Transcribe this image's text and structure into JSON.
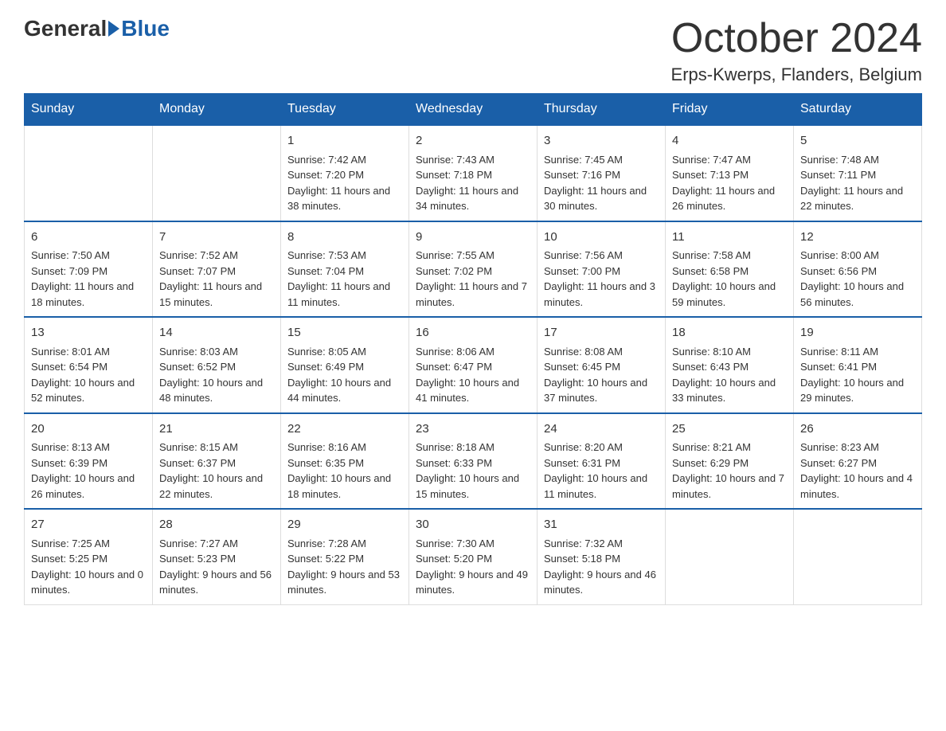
{
  "header": {
    "logo_general": "General",
    "logo_blue": "Blue",
    "month_title": "October 2024",
    "location": "Erps-Kwerps, Flanders, Belgium"
  },
  "weekdays": [
    "Sunday",
    "Monday",
    "Tuesday",
    "Wednesday",
    "Thursday",
    "Friday",
    "Saturday"
  ],
  "weeks": [
    [
      {
        "day": "",
        "sunrise": "",
        "sunset": "",
        "daylight": ""
      },
      {
        "day": "",
        "sunrise": "",
        "sunset": "",
        "daylight": ""
      },
      {
        "day": "1",
        "sunrise": "Sunrise: 7:42 AM",
        "sunset": "Sunset: 7:20 PM",
        "daylight": "Daylight: 11 hours and 38 minutes."
      },
      {
        "day": "2",
        "sunrise": "Sunrise: 7:43 AM",
        "sunset": "Sunset: 7:18 PM",
        "daylight": "Daylight: 11 hours and 34 minutes."
      },
      {
        "day": "3",
        "sunrise": "Sunrise: 7:45 AM",
        "sunset": "Sunset: 7:16 PM",
        "daylight": "Daylight: 11 hours and 30 minutes."
      },
      {
        "day": "4",
        "sunrise": "Sunrise: 7:47 AM",
        "sunset": "Sunset: 7:13 PM",
        "daylight": "Daylight: 11 hours and 26 minutes."
      },
      {
        "day": "5",
        "sunrise": "Sunrise: 7:48 AM",
        "sunset": "Sunset: 7:11 PM",
        "daylight": "Daylight: 11 hours and 22 minutes."
      }
    ],
    [
      {
        "day": "6",
        "sunrise": "Sunrise: 7:50 AM",
        "sunset": "Sunset: 7:09 PM",
        "daylight": "Daylight: 11 hours and 18 minutes."
      },
      {
        "day": "7",
        "sunrise": "Sunrise: 7:52 AM",
        "sunset": "Sunset: 7:07 PM",
        "daylight": "Daylight: 11 hours and 15 minutes."
      },
      {
        "day": "8",
        "sunrise": "Sunrise: 7:53 AM",
        "sunset": "Sunset: 7:04 PM",
        "daylight": "Daylight: 11 hours and 11 minutes."
      },
      {
        "day": "9",
        "sunrise": "Sunrise: 7:55 AM",
        "sunset": "Sunset: 7:02 PM",
        "daylight": "Daylight: 11 hours and 7 minutes."
      },
      {
        "day": "10",
        "sunrise": "Sunrise: 7:56 AM",
        "sunset": "Sunset: 7:00 PM",
        "daylight": "Daylight: 11 hours and 3 minutes."
      },
      {
        "day": "11",
        "sunrise": "Sunrise: 7:58 AM",
        "sunset": "Sunset: 6:58 PM",
        "daylight": "Daylight: 10 hours and 59 minutes."
      },
      {
        "day": "12",
        "sunrise": "Sunrise: 8:00 AM",
        "sunset": "Sunset: 6:56 PM",
        "daylight": "Daylight: 10 hours and 56 minutes."
      }
    ],
    [
      {
        "day": "13",
        "sunrise": "Sunrise: 8:01 AM",
        "sunset": "Sunset: 6:54 PM",
        "daylight": "Daylight: 10 hours and 52 minutes."
      },
      {
        "day": "14",
        "sunrise": "Sunrise: 8:03 AM",
        "sunset": "Sunset: 6:52 PM",
        "daylight": "Daylight: 10 hours and 48 minutes."
      },
      {
        "day": "15",
        "sunrise": "Sunrise: 8:05 AM",
        "sunset": "Sunset: 6:49 PM",
        "daylight": "Daylight: 10 hours and 44 minutes."
      },
      {
        "day": "16",
        "sunrise": "Sunrise: 8:06 AM",
        "sunset": "Sunset: 6:47 PM",
        "daylight": "Daylight: 10 hours and 41 minutes."
      },
      {
        "day": "17",
        "sunrise": "Sunrise: 8:08 AM",
        "sunset": "Sunset: 6:45 PM",
        "daylight": "Daylight: 10 hours and 37 minutes."
      },
      {
        "day": "18",
        "sunrise": "Sunrise: 8:10 AM",
        "sunset": "Sunset: 6:43 PM",
        "daylight": "Daylight: 10 hours and 33 minutes."
      },
      {
        "day": "19",
        "sunrise": "Sunrise: 8:11 AM",
        "sunset": "Sunset: 6:41 PM",
        "daylight": "Daylight: 10 hours and 29 minutes."
      }
    ],
    [
      {
        "day": "20",
        "sunrise": "Sunrise: 8:13 AM",
        "sunset": "Sunset: 6:39 PM",
        "daylight": "Daylight: 10 hours and 26 minutes."
      },
      {
        "day": "21",
        "sunrise": "Sunrise: 8:15 AM",
        "sunset": "Sunset: 6:37 PM",
        "daylight": "Daylight: 10 hours and 22 minutes."
      },
      {
        "day": "22",
        "sunrise": "Sunrise: 8:16 AM",
        "sunset": "Sunset: 6:35 PM",
        "daylight": "Daylight: 10 hours and 18 minutes."
      },
      {
        "day": "23",
        "sunrise": "Sunrise: 8:18 AM",
        "sunset": "Sunset: 6:33 PM",
        "daylight": "Daylight: 10 hours and 15 minutes."
      },
      {
        "day": "24",
        "sunrise": "Sunrise: 8:20 AM",
        "sunset": "Sunset: 6:31 PM",
        "daylight": "Daylight: 10 hours and 11 minutes."
      },
      {
        "day": "25",
        "sunrise": "Sunrise: 8:21 AM",
        "sunset": "Sunset: 6:29 PM",
        "daylight": "Daylight: 10 hours and 7 minutes."
      },
      {
        "day": "26",
        "sunrise": "Sunrise: 8:23 AM",
        "sunset": "Sunset: 6:27 PM",
        "daylight": "Daylight: 10 hours and 4 minutes."
      }
    ],
    [
      {
        "day": "27",
        "sunrise": "Sunrise: 7:25 AM",
        "sunset": "Sunset: 5:25 PM",
        "daylight": "Daylight: 10 hours and 0 minutes."
      },
      {
        "day": "28",
        "sunrise": "Sunrise: 7:27 AM",
        "sunset": "Sunset: 5:23 PM",
        "daylight": "Daylight: 9 hours and 56 minutes."
      },
      {
        "day": "29",
        "sunrise": "Sunrise: 7:28 AM",
        "sunset": "Sunset: 5:22 PM",
        "daylight": "Daylight: 9 hours and 53 minutes."
      },
      {
        "day": "30",
        "sunrise": "Sunrise: 7:30 AM",
        "sunset": "Sunset: 5:20 PM",
        "daylight": "Daylight: 9 hours and 49 minutes."
      },
      {
        "day": "31",
        "sunrise": "Sunrise: 7:32 AM",
        "sunset": "Sunset: 5:18 PM",
        "daylight": "Daylight: 9 hours and 46 minutes."
      },
      {
        "day": "",
        "sunrise": "",
        "sunset": "",
        "daylight": ""
      },
      {
        "day": "",
        "sunrise": "",
        "sunset": "",
        "daylight": ""
      }
    ]
  ]
}
